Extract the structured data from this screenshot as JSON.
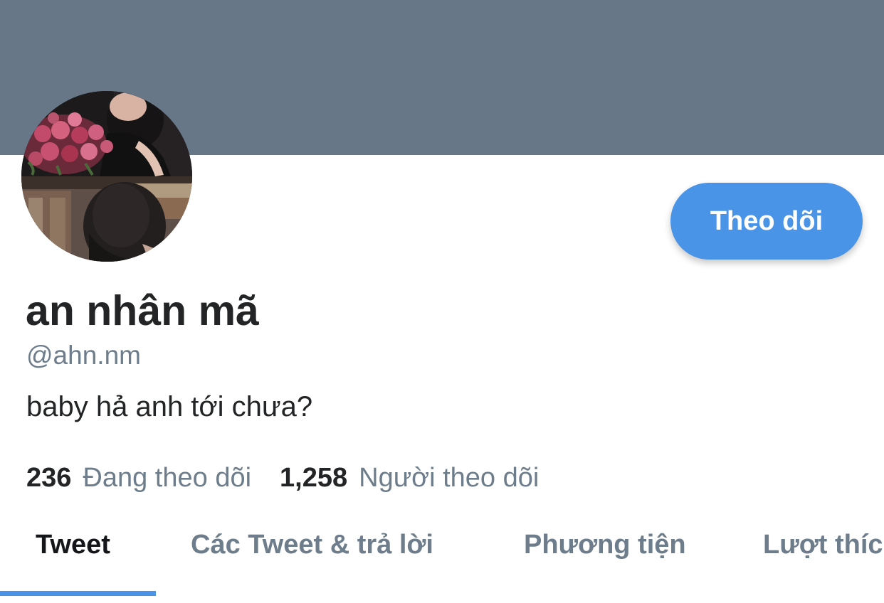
{
  "profile": {
    "display_name": "an nhân mã",
    "handle": "@ahn.nm",
    "bio": "baby hả anh tới chưa?",
    "follow_button_label": "Theo dõi"
  },
  "stats": {
    "following_count": "236",
    "following_label": "Đang theo dõi",
    "followers_count": "1,258",
    "followers_label": "Người theo dõi"
  },
  "tabs": [
    {
      "label": "Tweet",
      "active": true
    },
    {
      "label": "Các Tweet & trả lời",
      "active": false
    },
    {
      "label": "Phương tiện",
      "active": false
    },
    {
      "label": "Lượt thích",
      "active": false
    }
  ],
  "colors": {
    "banner": "#687787",
    "accent": "#4a94e8",
    "text_primary": "#222426",
    "text_secondary": "#6e7d8b"
  }
}
